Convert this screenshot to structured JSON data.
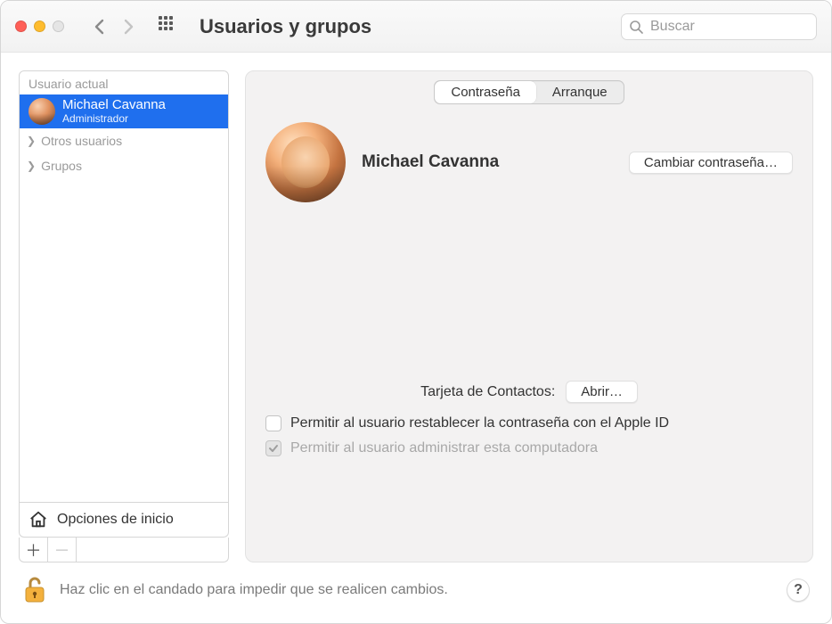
{
  "title": "Usuarios y grupos",
  "search_placeholder": "Buscar",
  "sidebar": {
    "header": "Usuario actual",
    "current": {
      "name": "Michael Cavanna",
      "role": "Administrador"
    },
    "otros": "Otros usuarios",
    "grupos": "Grupos",
    "login_options": "Opciones de inicio"
  },
  "tabs": {
    "password": "Contraseña",
    "startup": "Arranque"
  },
  "main": {
    "display_name": "Michael Cavanna",
    "change_password": "Cambiar contraseña…",
    "contacts_label": "Tarjeta de Contactos:",
    "open_label": "Abrir…",
    "allow_reset": "Permitir al usuario restablecer la contraseña con el Apple ID",
    "allow_admin": "Permitir al usuario administrar esta computadora"
  },
  "footer": {
    "lock_text": "Haz clic en el candado para impedir que se realicen cambios.",
    "help": "?"
  }
}
